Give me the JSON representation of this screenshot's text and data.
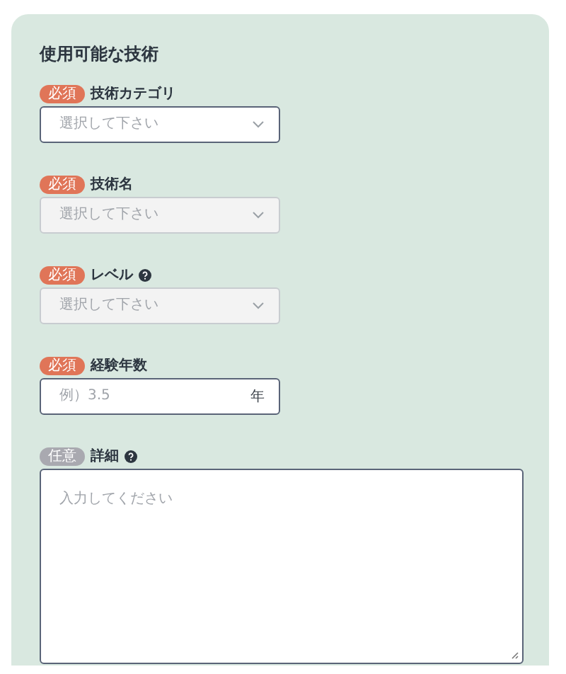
{
  "section": {
    "title": "使用可能な技術"
  },
  "fields": [
    {
      "kind": "select",
      "label": "技術カテゴリ",
      "badge": "必須",
      "required": true,
      "help": false,
      "disabled": false,
      "placeholder": "選択して下さい"
    },
    {
      "kind": "select",
      "label": "技術名",
      "badge": "必須",
      "required": true,
      "help": false,
      "disabled": true,
      "placeholder": "選択して下さい"
    },
    {
      "kind": "select",
      "label": "レベル",
      "badge": "必須",
      "required": true,
      "help": true,
      "disabled": true,
      "placeholder": "選択して下さい"
    },
    {
      "kind": "number",
      "label": "経験年数",
      "badge": "必須",
      "required": true,
      "help": false,
      "disabled": false,
      "placeholder": "例）3.5",
      "unit": "年"
    },
    {
      "kind": "textarea",
      "label": "詳細",
      "badge": "任意",
      "required": false,
      "help": true,
      "disabled": false,
      "placeholder": "入力してください"
    }
  ]
}
